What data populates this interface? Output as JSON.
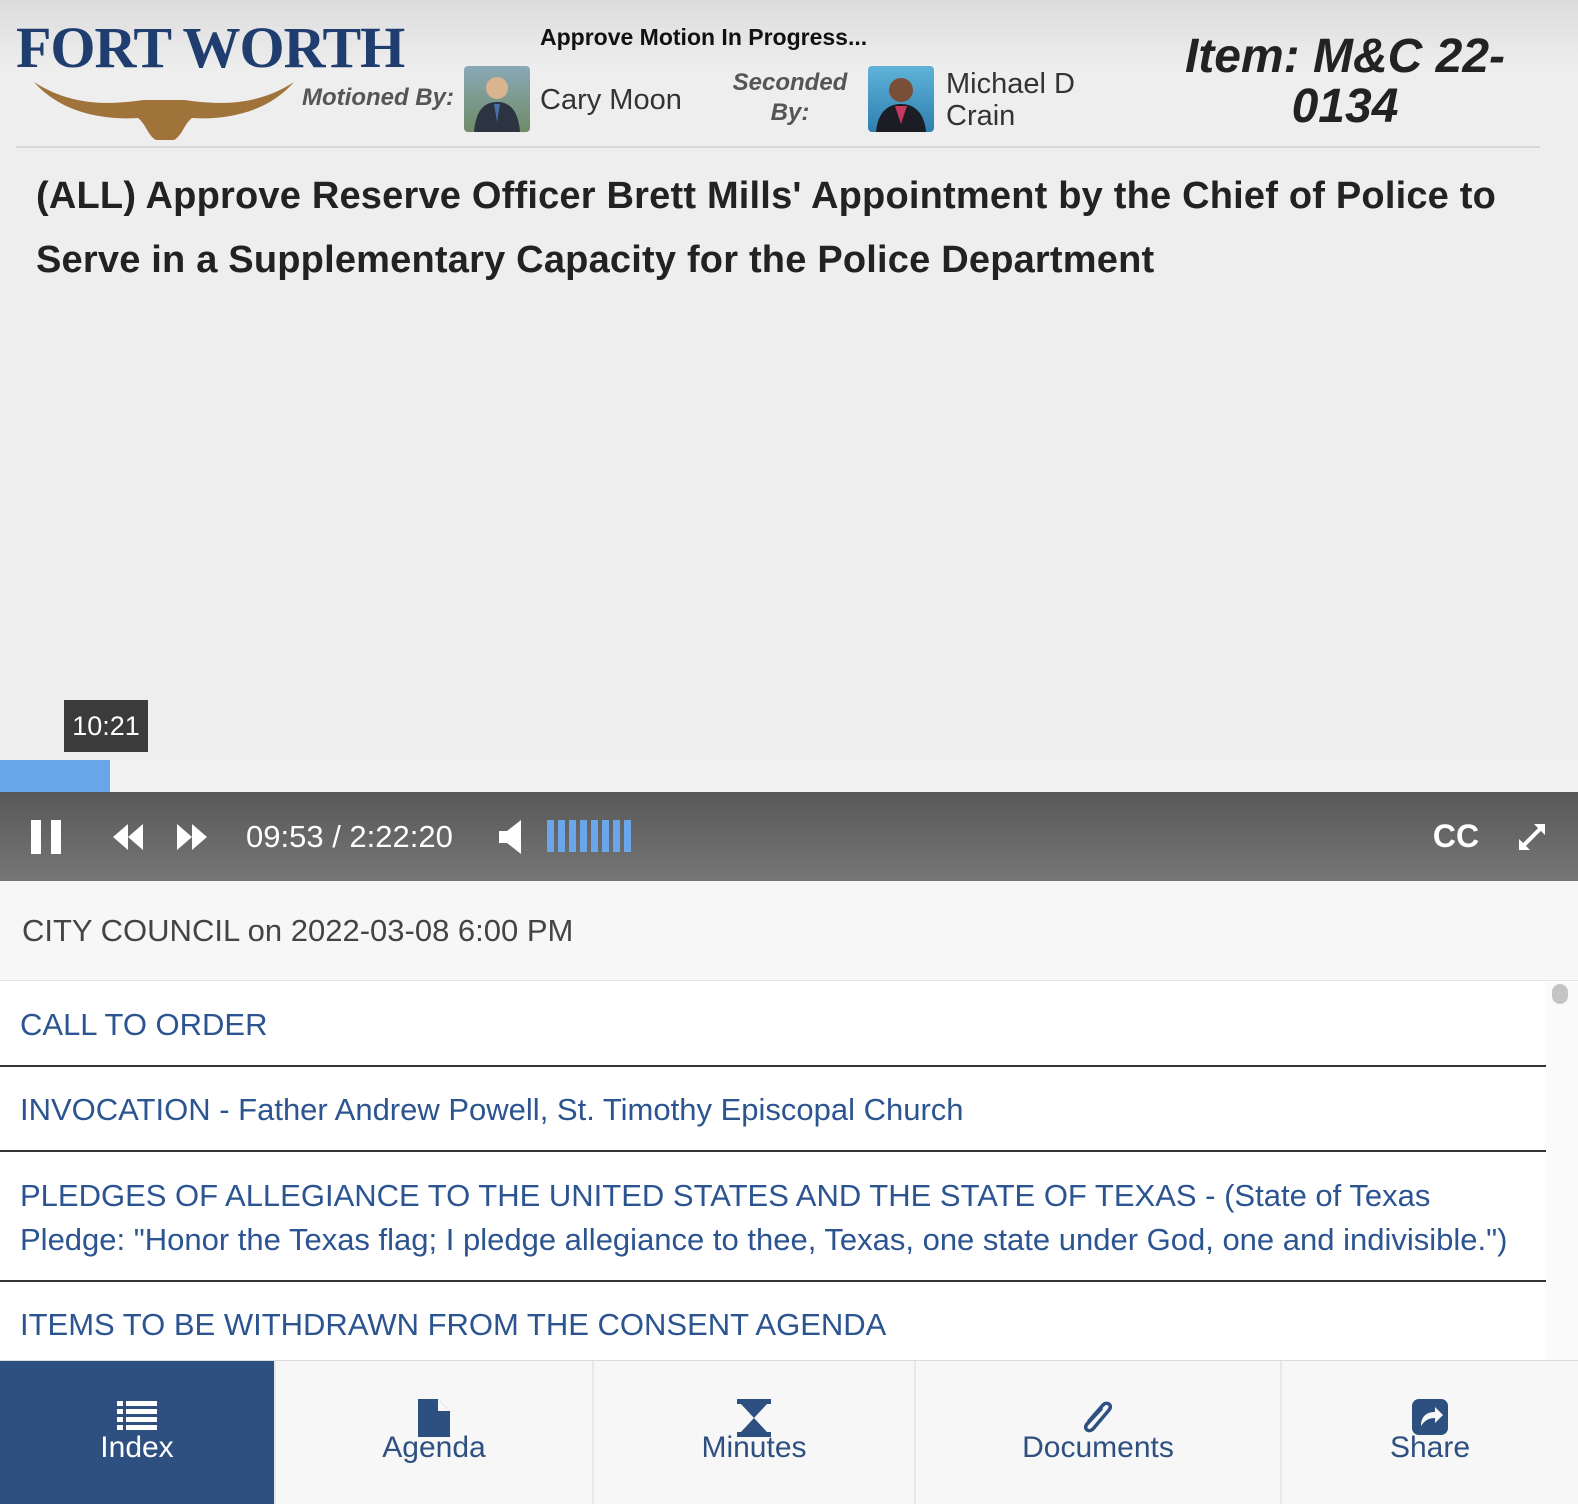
{
  "header": {
    "logo": {
      "text_large": "FORT",
      "text_large2": "WORTH",
      "registered": "®"
    },
    "motion_status": "Approve Motion In Progress...",
    "motioned_by_label": "Motioned By:",
    "motioned_by_name": "Cary Moon",
    "seconded_by_label": "Seconded By:",
    "seconded_by_name": "Michael D Crain",
    "item_id": "Item: M&C 22-0134"
  },
  "item_description": {
    "line1": "(ALL) Approve Reserve Officer Brett Mills' Appointment by the Chief of Police to",
    "line2": "Serve in a Supplementary Capacity for the Police Department"
  },
  "player": {
    "hover_time": "10:21",
    "time_display": "09:53 / 2:22:20",
    "progress_fraction": 0.0695,
    "volume_level": 8,
    "cc_label": "CC",
    "accent_color": "#6aa6ea"
  },
  "meeting": {
    "title": "CITY COUNCIL on 2022-03-08 6:00 PM"
  },
  "agenda": {
    "items": [
      {
        "label": "CALL TO ORDER"
      },
      {
        "label": "INVOCATION - Father Andrew Powell, St. Timothy Episcopal Church"
      },
      {
        "label": "PLEDGES OF ALLEGIANCE TO THE UNITED STATES AND THE STATE OF TEXAS - (State of Texas Pledge: \"Honor the Texas flag; I pledge allegiance to thee, Texas, one state under God, one and indivisible.\")"
      },
      {
        "label": "ITEMS TO BE WITHDRAWN FROM THE CONSENT AGENDA"
      }
    ]
  },
  "tabs": [
    {
      "label": "Index",
      "icon": "list-icon",
      "active": true
    },
    {
      "label": "Agenda",
      "icon": "document-icon",
      "active": false
    },
    {
      "label": "Minutes",
      "icon": "hourglass-icon",
      "active": false
    },
    {
      "label": "Documents",
      "icon": "paperclip-icon",
      "active": false
    },
    {
      "label": "Share",
      "icon": "share-icon",
      "active": false
    }
  ],
  "colors": {
    "brand_navy": "#2e5080",
    "link_blue": "#2b5490",
    "logo_brown": "#a0733a"
  }
}
